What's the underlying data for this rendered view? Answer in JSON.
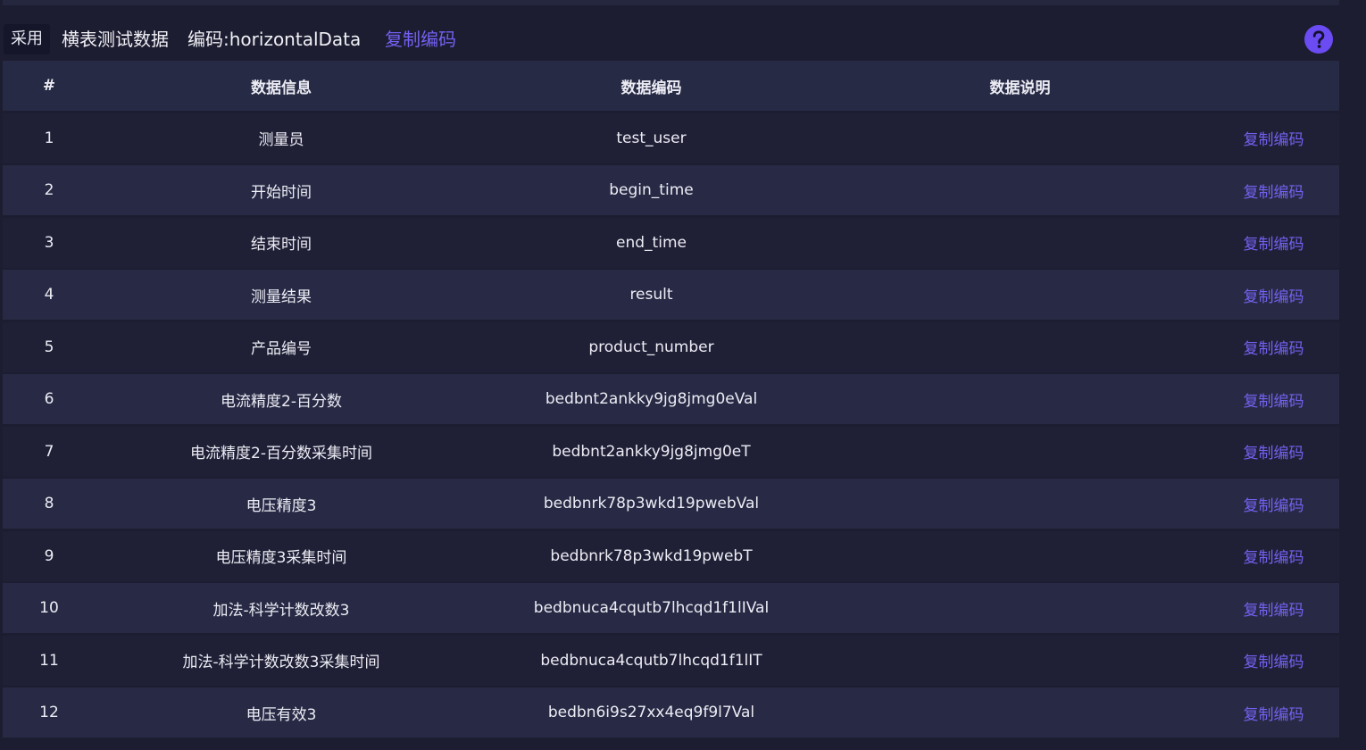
{
  "header": {
    "adopt_badge": "采用",
    "dataset_name": "横表测试数据",
    "code_label": "编码:",
    "code_value": "horizontalData",
    "copy_code": "复制编码",
    "help_icon": "question-mark-icon"
  },
  "table": {
    "columns": {
      "index": "#",
      "info": "数据信息",
      "code": "数据编码",
      "desc": "数据说明"
    },
    "rows": [
      {
        "index": "1",
        "info": "测量员",
        "code": "test_user",
        "desc": "",
        "action": "复制编码"
      },
      {
        "index": "2",
        "info": "开始时间",
        "code": "begin_time",
        "desc": "",
        "action": "复制编码"
      },
      {
        "index": "3",
        "info": "结束时间",
        "code": "end_time",
        "desc": "",
        "action": "复制编码"
      },
      {
        "index": "4",
        "info": "测量结果",
        "code": "result",
        "desc": "",
        "action": "复制编码"
      },
      {
        "index": "5",
        "info": "产品编号",
        "code": "product_number",
        "desc": "",
        "action": "复制编码"
      },
      {
        "index": "6",
        "info": "电流精度2-百分数",
        "code": "bedbnt2ankky9jg8jmg0eVal",
        "desc": "",
        "action": "复制编码"
      },
      {
        "index": "7",
        "info": "电流精度2-百分数采集时间",
        "code": "bedbnt2ankky9jg8jmg0eT",
        "desc": "",
        "action": "复制编码"
      },
      {
        "index": "8",
        "info": "电压精度3",
        "code": "bedbnrk78p3wkd19pwebVal",
        "desc": "",
        "action": "复制编码"
      },
      {
        "index": "9",
        "info": "电压精度3采集时间",
        "code": "bedbnrk78p3wkd19pwebT",
        "desc": "",
        "action": "复制编码"
      },
      {
        "index": "10",
        "info": "加法-科学计数改数3",
        "code": "bedbnuca4cqutb7lhcqd1f1lIVal",
        "desc": "",
        "action": "复制编码"
      },
      {
        "index": "11",
        "info": "加法-科学计数改数3采集时间",
        "code": "bedbnuca4cqutb7lhcqd1f1lIT",
        "desc": "",
        "action": "复制编码"
      },
      {
        "index": "12",
        "info": "电压有效3",
        "code": "bedbn6i9s27xx4eq9f9l7Val",
        "desc": "",
        "action": "复制编码"
      }
    ]
  },
  "colors": {
    "background": "#1c1d30",
    "row_alt": "#282a45",
    "accent_link": "#7361f0",
    "help_button": "#6a4cf2"
  }
}
